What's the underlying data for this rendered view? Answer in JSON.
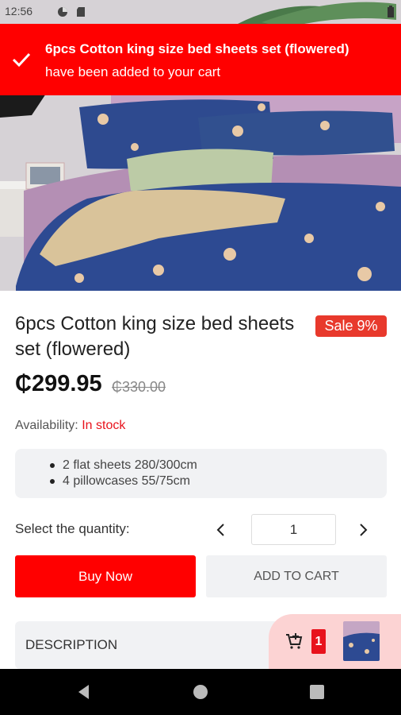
{
  "status_bar": {
    "time": "12:56"
  },
  "toast": {
    "title": "6pcs Cotton king size bed sheets set (flowered)",
    "message": "have been added to your cart"
  },
  "product": {
    "title": "6pcs Cotton king size bed sheets set (flowered)",
    "sale_badge": "Sale 9%",
    "price": "₵299.95",
    "old_price": "₵330.00",
    "availability_label": "Availability:",
    "availability_value": "In stock",
    "features": [
      "2 flat sheets 280/300cm",
      "4 pillowcases 55/75cm"
    ]
  },
  "quantity": {
    "label": "Select the quantity:",
    "value": "1"
  },
  "actions": {
    "buy_now": "Buy Now",
    "add_to_cart": "ADD TO CART"
  },
  "description": {
    "label": "DESCRIPTION"
  },
  "cart": {
    "count": "1"
  },
  "colors": {
    "accent": "#ff0000",
    "sale": "#e8392c",
    "cart_bg": "#fcd3d3",
    "bedding": "#2e4a8f"
  }
}
